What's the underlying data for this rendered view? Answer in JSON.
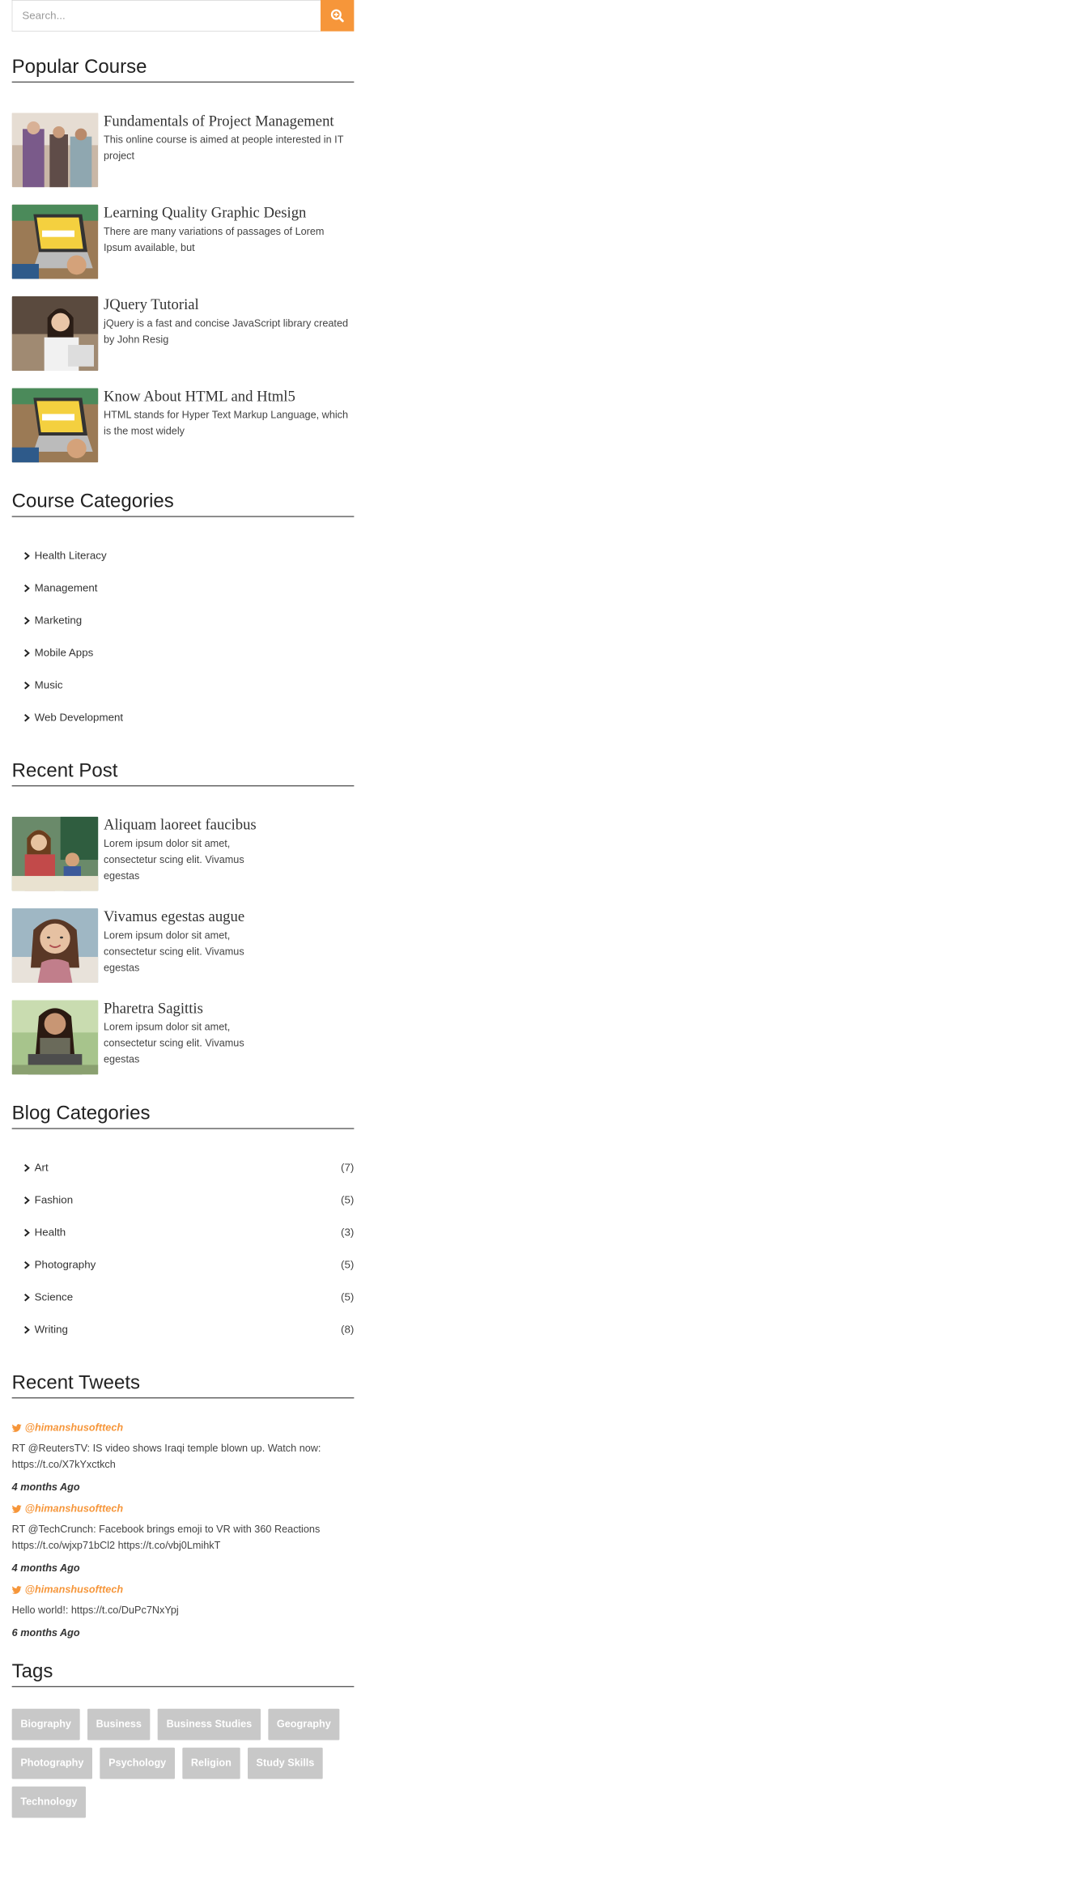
{
  "search": {
    "placeholder": "Search..."
  },
  "popular_course": {
    "title": "Popular Course",
    "items": [
      {
        "title": "Fundamentals of Project Management",
        "desc": "This online course is aimed at people interested in IT project"
      },
      {
        "title": "Learning Quality Graphic Design",
        "desc": "There are many variations of passages of Lorem Ipsum available, but"
      },
      {
        "title": "JQuery Tutorial",
        "desc": "jQuery is a fast and concise JavaScript library created by John Resig"
      },
      {
        "title": "Know About HTML and Html5",
        "desc": "HTML stands for Hyper Text Markup Language, which is the most widely"
      }
    ]
  },
  "course_categories": {
    "title": "Course Categories",
    "items": [
      "Health Literacy",
      "Management",
      "Marketing",
      "Mobile Apps",
      "Music",
      "Web Development"
    ]
  },
  "recent_post": {
    "title": "Recent Post",
    "items": [
      {
        "title": "Aliquam laoreet faucibus",
        "desc": "Lorem ipsum dolor sit amet, consectetur scing elit. Vivamus egestas"
      },
      {
        "title": "Vivamus egestas augue",
        "desc": "Lorem ipsum dolor sit amet, consectetur scing elit. Vivamus egestas"
      },
      {
        "title": "Pharetra Sagittis",
        "desc": "Lorem ipsum dolor sit amet, consectetur scing elit. Vivamus egestas"
      }
    ]
  },
  "blog_categories": {
    "title": "Blog Categories",
    "items": [
      {
        "label": "Art",
        "count": "(7)"
      },
      {
        "label": "Fashion",
        "count": "(5)"
      },
      {
        "label": "Health",
        "count": "(3)"
      },
      {
        "label": "Photography",
        "count": "(5)"
      },
      {
        "label": "Science",
        "count": "(5)"
      },
      {
        "label": "Writing",
        "count": "(8)"
      }
    ]
  },
  "recent_tweets": {
    "title": "Recent Tweets",
    "items": [
      {
        "handle": "@himanshusofttech",
        "text": "RT @ReutersTV: IS video shows Iraqi temple blown up. Watch now: https://t.co/X7kYxctkch",
        "time": "4 months Ago"
      },
      {
        "handle": "@himanshusofttech",
        "text": "RT @TechCrunch: Facebook brings emoji to VR with 360 Reactions https://t.co/wjxp71bCl2 https://t.co/vbj0LmihkT",
        "time": "4 months Ago"
      },
      {
        "handle": "@himanshusofttech",
        "text": "Hello world!: https://t.co/DuPc7NxYpj",
        "time": "6 months Ago"
      }
    ]
  },
  "tags": {
    "title": "Tags",
    "items": [
      "Biography",
      "Business",
      "Business Studies",
      "Geography",
      "Photography",
      "Psychology",
      "Religion",
      "Study Skills",
      "Technology"
    ]
  },
  "colors": {
    "accent": "#f6963a",
    "tag_bg": "#c8c8c8",
    "heading_rule": "#555555"
  }
}
